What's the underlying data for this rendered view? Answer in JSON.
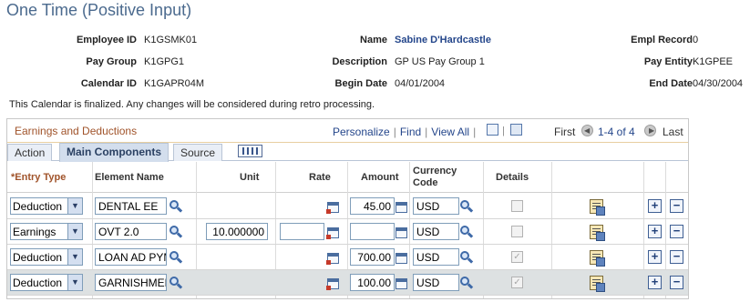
{
  "page": {
    "title": "One Time (Positive Input)"
  },
  "header_fields": {
    "employee_id": {
      "label": "Employee ID",
      "value": "K1GSMK01"
    },
    "name": {
      "label": "Name",
      "value": "Sabine D'Hardcastle"
    },
    "empl_record": {
      "label": "Empl Record",
      "value": "0"
    },
    "pay_group": {
      "label": "Pay Group",
      "value": "K1GPG1"
    },
    "description": {
      "label": "Description",
      "value": "GP US Pay Group 1"
    },
    "pay_entity": {
      "label": "Pay Entity",
      "value": "K1GPEE"
    },
    "calendar_id": {
      "label": "Calendar ID",
      "value": "K1GAPR04M"
    },
    "begin_date": {
      "label": "Begin Date",
      "value": "04/01/2004"
    },
    "end_date": {
      "label": "End Date",
      "value": "04/30/2004"
    }
  },
  "notice": "This Calendar is finalized. Any changes will be considered during retro processing.",
  "grid": {
    "title": "Earnings and Deductions",
    "nav": {
      "personalize": "Personalize",
      "find": "Find",
      "view_all": "View All"
    },
    "paging": {
      "first": "First",
      "range": "1-4 of 4",
      "last": "Last"
    },
    "tabs": [
      "Action",
      "Main Components",
      "Source"
    ],
    "active_tab": "Main Components",
    "columns": {
      "entry_type": "*Entry Type",
      "element_name": "Element Name",
      "unit": "Unit",
      "rate": "Rate",
      "amount": "Amount",
      "currency_1": "Currency",
      "currency_2": "Code",
      "details": "Details"
    },
    "rows": [
      {
        "entry_type": "Deduction",
        "element_name": "DENTAL EE",
        "unit": "",
        "rate": "",
        "amount": "45.00",
        "currency": "USD",
        "details_checked": false
      },
      {
        "entry_type": "Earnings",
        "element_name": "OVT 2.0",
        "unit": "10.000000",
        "rate": "",
        "amount": "",
        "currency": "USD",
        "details_checked": false
      },
      {
        "entry_type": "Deduction",
        "element_name": "LOAN AD PYM",
        "unit": "",
        "rate": "",
        "amount": "700.00",
        "currency": "USD",
        "details_checked": true
      },
      {
        "entry_type": "Deduction",
        "element_name": "GARNISHMEN",
        "unit": "",
        "rate": "",
        "amount": "100.00",
        "currency": "USD",
        "details_checked": true
      }
    ]
  },
  "icons": {
    "lookup": "magnifier-icon",
    "calculator": "calculator-icon",
    "details": "details-icon",
    "add": "add-row-icon",
    "delete": "delete-row-icon"
  },
  "colors": {
    "title": "#4b6a8e",
    "grid_title": "#a0532a",
    "link": "#24468b",
    "alt_row": "#dde1e2"
  }
}
